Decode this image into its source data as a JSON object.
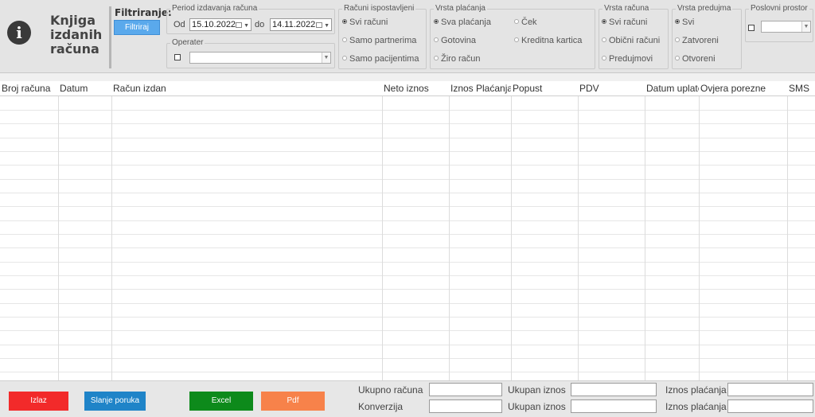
{
  "header": {
    "title_line1": "Knjiga",
    "title_line2": "izdanih",
    "title_line3": "računa",
    "filter_label": "Filtriranje:",
    "filter_button": "Filtriraj"
  },
  "period": {
    "legend": "Period izdavanja računa",
    "from_label": "Od",
    "from_value": "15.10.2022",
    "to_label": "do",
    "to_value": "14.11.2022"
  },
  "operater": {
    "legend": "Operater"
  },
  "racuni_ispostavljeni": {
    "legend": "Računi ispostavljeni",
    "options": [
      "Svi računi",
      "Samo partnerima",
      "Samo pacijentima"
    ]
  },
  "vrsta_placanja": {
    "legend": "Vrsta plaćanja",
    "options": [
      "Sva plaćanja",
      "Gotovina",
      "Žiro račun",
      "Ček",
      "Kreditna kartica"
    ]
  },
  "vrsta_racuna": {
    "legend": "Vrsta računa",
    "options": [
      "Svi računi",
      "Obični računi",
      "Predujmovi"
    ]
  },
  "vrsta_predujma": {
    "legend": "Vrsta predujma",
    "options": [
      "Svi",
      "Zatvoreni",
      "Otvoreni"
    ]
  },
  "poslovni_prostor": {
    "legend": "Poslovni prostor"
  },
  "table": {
    "columns": [
      "Broj računa",
      "Datum",
      "Račun izdan",
      "Neto iznos",
      "Iznos Plaćanja",
      "Popust",
      "PDV",
      "Datum uplate",
      "Ovjera porezne",
      "SMS"
    ]
  },
  "footer": {
    "btn_izlaz": "Izlaz",
    "btn_slanje": "Slanje poruka",
    "btn_excel": "Excel",
    "btn_pdf": "Pdf",
    "lbl_ukupno_racuna": "Ukupno računa",
    "lbl_ukupan_iznos_1": "Ukupan iznos",
    "lbl_iznos_placanja_1": "Iznos plaćanja",
    "lbl_konverzija": "Konverzija",
    "lbl_ukupan_iznos_2": "Ukupan iznos",
    "lbl_iznos_placanja_2": "Iznos plaćanja"
  },
  "colors": {
    "izlaz": "#f22a2a",
    "slanje": "#1f84c8",
    "excel": "#0d8a1b",
    "pdf": "#f7824a",
    "filter_button": "#5aa9ec"
  }
}
